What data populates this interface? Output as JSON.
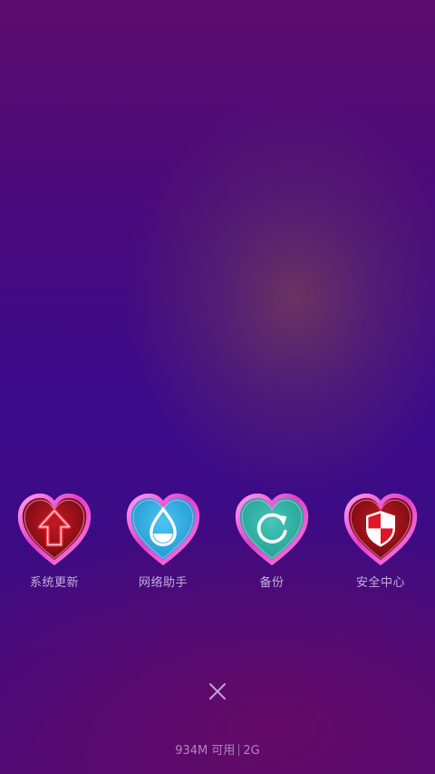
{
  "dock": {
    "items": [
      {
        "label": "系统更新",
        "icon": "upgrade-arrow-icon",
        "fill": "#9a1010"
      },
      {
        "label": "网络助手",
        "icon": "water-drop-icon",
        "fill": "#28a8dc"
      },
      {
        "label": "备份",
        "icon": "backup-refresh-icon",
        "fill": "#2fb0a6"
      },
      {
        "label": "安全中心",
        "icon": "shield-icon",
        "fill": "#a51018"
      }
    ],
    "heart_border_color": "#ff6fe0"
  },
  "close": {
    "icon": "close-icon"
  },
  "status": {
    "memory": "934M 可用",
    "network": "2G"
  }
}
